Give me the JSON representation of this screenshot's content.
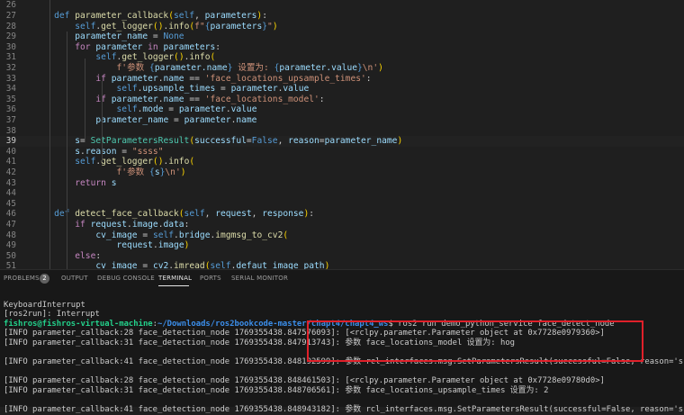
{
  "editor": {
    "active_line": "39",
    "lines": [
      {
        "n": "26",
        "code": ""
      },
      {
        "n": "27",
        "code": "    def parameter_callback(self, parameters):"
      },
      {
        "n": "28",
        "code": "        self.get_logger().info(f\"{parameters}\")"
      },
      {
        "n": "29",
        "code": "        parameter_name = None"
      },
      {
        "n": "30",
        "code": "        for parameter in parameters:"
      },
      {
        "n": "31",
        "code": "            self.get_logger().info("
      },
      {
        "n": "32",
        "code": "                f'参数 {parameter.name} 设置为: {parameter.value}\\n')"
      },
      {
        "n": "33",
        "code": "            if parameter.name == 'face_locations_upsample_times':"
      },
      {
        "n": "34",
        "code": "                self.upsample_times = parameter.value"
      },
      {
        "n": "35",
        "code": "            if parameter.name == 'face_locations_model':"
      },
      {
        "n": "36",
        "code": "                self.mode = parameter.value"
      },
      {
        "n": "37",
        "code": "            parameter_name = parameter.name"
      },
      {
        "n": "38",
        "code": ""
      },
      {
        "n": "39",
        "code": "        s= SetParametersResult(successful=False, reason=parameter_name)"
      },
      {
        "n": "40",
        "code": "        s.reason = \"ssss\""
      },
      {
        "n": "41",
        "code": "        self.get_logger().info("
      },
      {
        "n": "42",
        "code": "                f'参数 {s}\\n')"
      },
      {
        "n": "43",
        "code": "        return s"
      },
      {
        "n": "44",
        "code": ""
      },
      {
        "n": "45",
        "code": ""
      },
      {
        "n": "46",
        "code": "    def detect_face_callback(self, request, response):"
      },
      {
        "n": "47",
        "code": "        if request.image.data:"
      },
      {
        "n": "48",
        "code": "            cv_image = self.bridge.imgmsg_to_cv2("
      },
      {
        "n": "49",
        "code": "                request.image)"
      },
      {
        "n": "50",
        "code": "        else:"
      },
      {
        "n": "51",
        "code": "            cv_image = cv2.imread(self.defaut_image_path)"
      }
    ]
  },
  "panel": {
    "tabs": [
      {
        "label": "PROBLEMS",
        "name": "tab-problems"
      },
      {
        "label": "OUTPUT",
        "name": "tab-output"
      },
      {
        "label": "DEBUG CONSOLE",
        "name": "tab-debug-console"
      },
      {
        "label": "TERMINAL",
        "name": "tab-terminal"
      },
      {
        "label": "PORTS",
        "name": "tab-ports"
      },
      {
        "label": "SERIAL MONITOR",
        "name": "tab-serial-monitor"
      }
    ],
    "active_tab": "TERMINAL",
    "problems_count": "2"
  },
  "terminal": {
    "lines": [
      "",
      "KeyboardInterrupt",
      "[ros2run]: Interrupt",
      "",
      "[INFO parameter_callback:28 face_detection_node 1769355438.847576093]: [<rclpy.parameter.Parameter object at 0x7728e0979360>]",
      "[INFO parameter_callback:31 face_detection_node 1769355438.847913743]: 参数 face_locations_model 设置为: hog",
      "",
      "[INFO parameter_callback:41 face_detection_node 1769355438.848192599]: 参数 rcl_interfaces.msg.SetParametersResult(successful=False, reason='ssss')",
      "",
      "[INFO parameter_callback:28 face_detection_node 1769355438.848461503]: [<rclpy.parameter.Parameter object at 0x7728e09780d0>]",
      "[INFO parameter_callback:31 face_detection_node 1769355438.848706561]: 参数 face_locations_upsample_times 设置为: 2",
      "",
      "[INFO parameter_callback:41 face_detection_node 1769355438.848943182]: 参数 rcl_interfaces.msg.SetParametersResult(successful=False, reason='ssss')"
    ],
    "prompt_user": "fishros@fishros-virtual-machine",
    "prompt_path": "~/Downloads/ros2bookcode-master/chapt4/chapt4_ws",
    "prompt_cmd": "$ ros2 run demo_python_service face_detect_node"
  },
  "colors": {
    "editor_bg": "#1f1f1f",
    "panel_bg": "#181818",
    "prompt_green": "#23d18b",
    "prompt_blue": "#3b8eea",
    "highlight_red": "#e0202a"
  }
}
